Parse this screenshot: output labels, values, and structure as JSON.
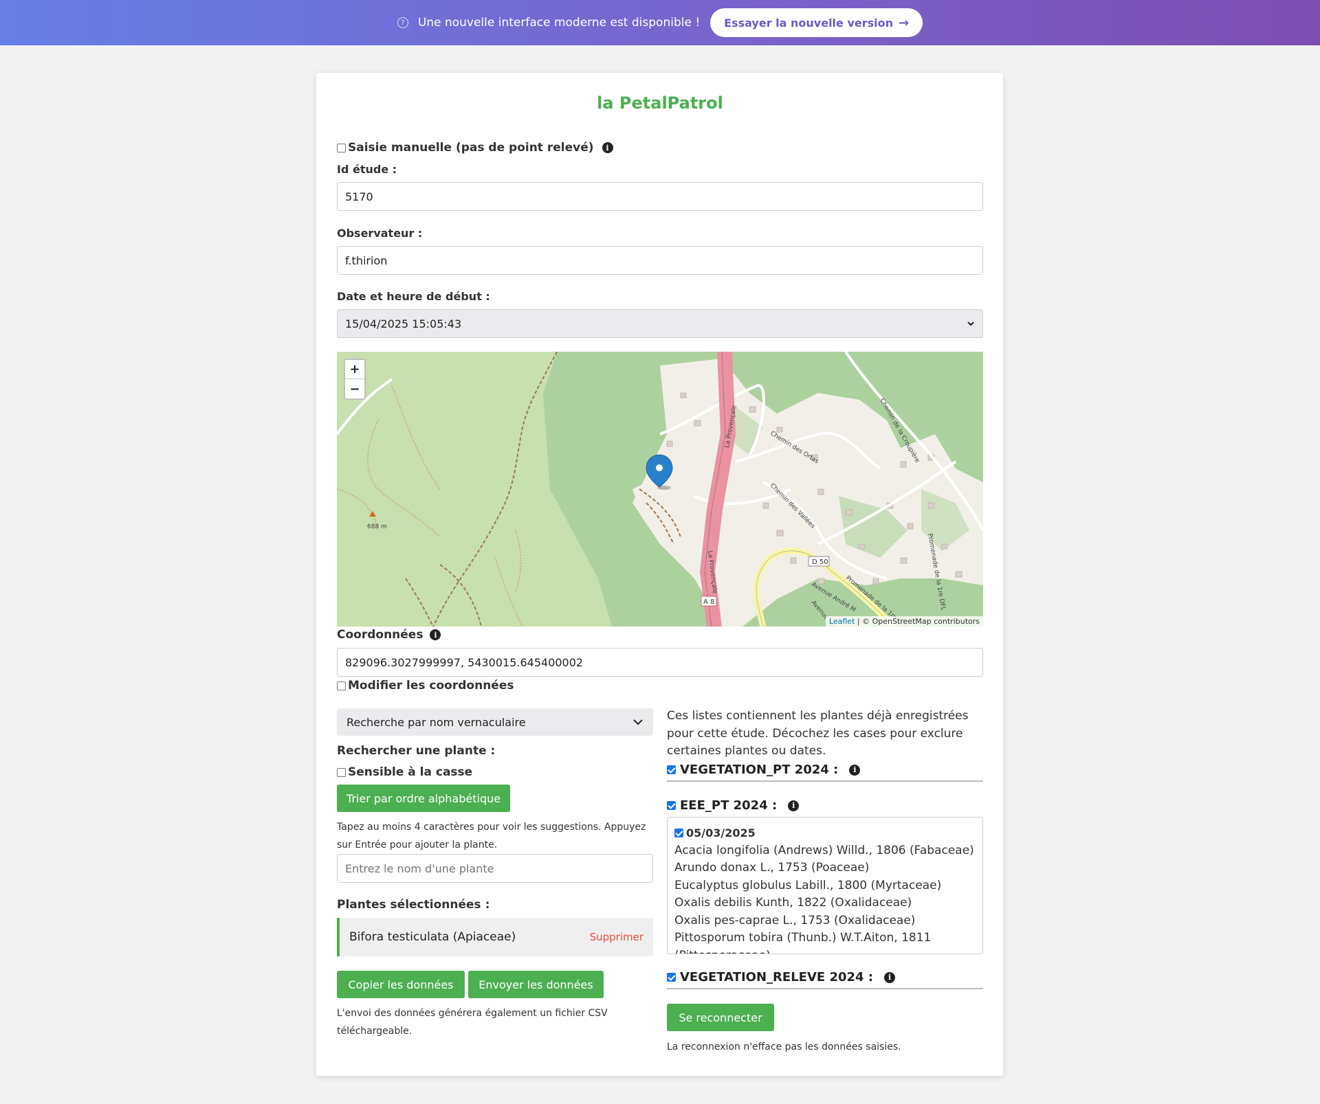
{
  "banner": {
    "message": "Une nouvelle interface moderne est disponible !",
    "button_label": "Essayer la nouvelle version",
    "icon": "help-circle-icon"
  },
  "app": {
    "title": "la PetalPatrol"
  },
  "form": {
    "manual_entry_label": "Saisie manuelle (pas de point relevé)",
    "manual_entry_checked": false,
    "study_id_label": "Id étude :",
    "study_id_value": "5170",
    "observer_label": "Observateur :",
    "observer_value": "f.thirion",
    "start_label": "Date et heure de début :",
    "start_value": "15/04/2025 15:05:43",
    "coords_label": "Coordonnées",
    "coords_value": "829096.3027999997, 5430015.645400002",
    "modify_coords_label": "Modifier les coordonnées",
    "modify_coords_checked": false
  },
  "map": {
    "zoom_in": "+",
    "zoom_out": "−",
    "attribution_link": "Leaflet",
    "attribution_text": " | © OpenStreetMap contributors",
    "labels": {
      "elevation": "688 m",
      "road_a8": "A 8",
      "road_d50": "D 50",
      "la_provencale": "La Provençale",
      "la_provencale_2": "La Provençale",
      "chemin_ortas": "Chemin des Ortas",
      "chemin_vallees": "Chemin des Vallées",
      "chemin_croupiere": "Chemin de la Croupière",
      "promenade_dfl": "Promenade de la 1re DFL",
      "promenade_1": "Promenade de la 1re DFL",
      "avenue_andre": "Avenue André M",
      "avenue_du": "Avenue du"
    }
  },
  "search": {
    "mode_value": "Recherche par nom vernaculaire",
    "search_label": "Rechercher une plante :",
    "case_sensitive_label": "Sensible à la casse",
    "case_sensitive_checked": false,
    "sort_button": "Trier par ordre alphabétique",
    "hint": "Tapez au moins 4 caractères pour voir les suggestions. Appuyez sur Entrée pour ajouter la plante.",
    "input_placeholder": "Entrez le nom d'une plante",
    "selected_label": "Plantes sélectionnées :",
    "selected_items": [
      {
        "name": "Bifora testiculata (Apiaceae)",
        "delete_label": "Supprimer"
      }
    ],
    "copy_button": "Copier les données",
    "send_button": "Envoyer les données",
    "send_note": "L'envoi des données générera également un fichier CSV téléchargeable."
  },
  "lists": {
    "intro": "Ces listes contiennent les plantes déjà enregistrées pour cette étude. Décochez les cases pour exclure certaines plantes ou dates.",
    "sections": [
      {
        "label": "VEGETATION_PT 2024 :",
        "checked": true
      },
      {
        "label": "EEE_PT 2024 :",
        "checked": true
      },
      {
        "label": "VEGETATION_RELEVE 2024 :",
        "checked": true
      }
    ],
    "eee_date": "05/03/2025",
    "eee_date_checked": true,
    "eee_plants": [
      "Acacia longifolia (Andrews) Willd., 1806 (Fabaceae)",
      "Arundo donax L., 1753 (Poaceae)",
      "Eucalyptus globulus Labill., 1800 (Myrtaceae)",
      "Oxalis debilis Kunth, 1822 (Oxalidaceae)",
      "Oxalis pes-caprae L., 1753 (Oxalidaceae)",
      "Pittosporum tobira (Thunb.) W.T.Aiton, 1811",
      "(Pittosporaceae)"
    ],
    "reconnect_button": "Se reconnecter",
    "reconnect_note": "La reconnexion n'efface pas les données saisies."
  }
}
